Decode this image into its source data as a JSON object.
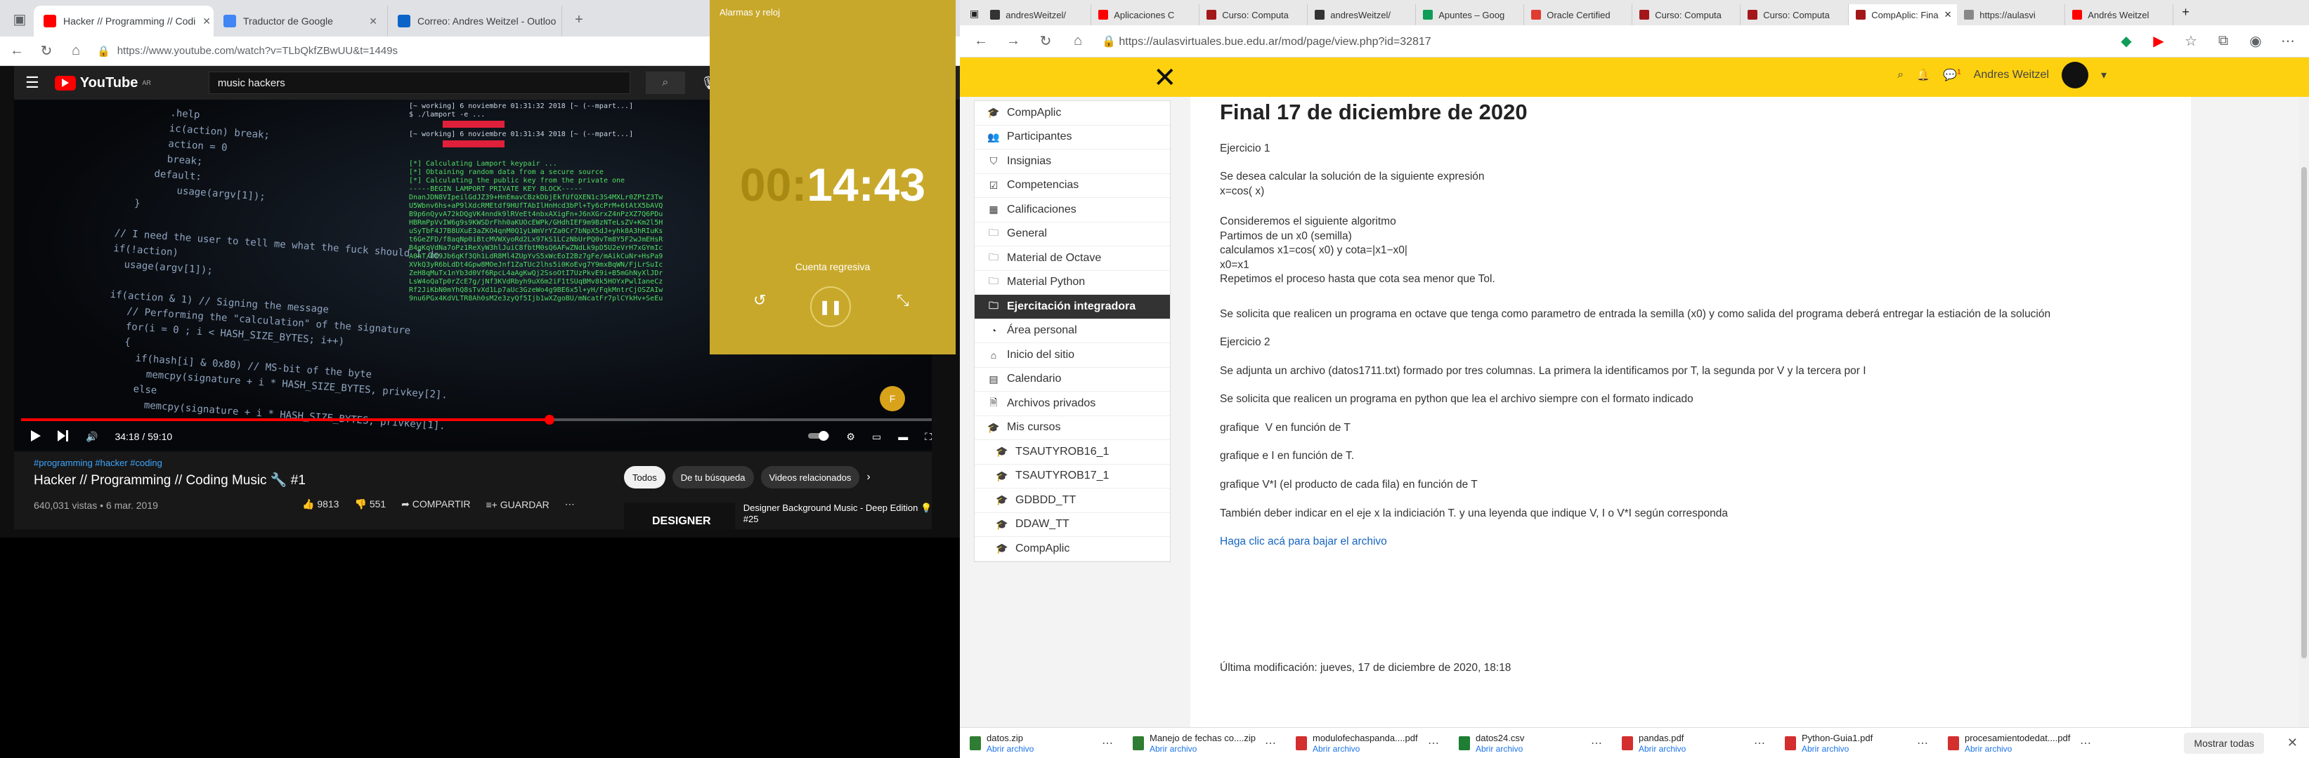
{
  "left_browser": {
    "tabs": [
      {
        "label": "Hacker // Programming // Codi",
        "color": "#ff0000"
      },
      {
        "label": "Traductor de Google",
        "color": "#4285f4"
      },
      {
        "label": "Correo: Andres Weitzel - Outloo",
        "color": "#0a64c8"
      }
    ],
    "url": "https://www.youtube.com/watch?v=TLbQkfZBwUU&t=1449s"
  },
  "youtube": {
    "logo": "YouTube",
    "country": "AR",
    "search": "music hackers",
    "code_lines": "        .help\n        ic(action) break;\n        action = 0\n        break;\n      default:\n          usage(argv[1]);\n   }\n\n// I need the user to tell me what the fuck should I do\nif(!action)\n  usage(argv[1]);\n\nif(action & 1) // Signing the message\n   // Performing the \"calculation\" of the signature\n   for(i = 0 ; i < HASH_SIZE_BYTES; i++)\n   {\n     if(hash[i] & 0x80) // MS-bit of the byte\n       memcpy(signature + i * HASH_SIZE_BYTES, privkey[2].\n     else\n       memcpy(signature + i * HASH_SIZE_BYTES, privkey[1].",
    "terminal_lines": "[*] Calculating Lamport keypair ...\n[*] Obtaining random data from a secure source\n[*] Calculating the public key from the private one\n-----BEGIN LAMPORT PRIVATE KEY BLOCK-----\nDnanJDN8VIpeilGdJZ39+HnEmavCBzkDbjEkfUfQXEN1c3S4MXLr0ZPtZ3Tw\nU5Wbnv6hs+aP9lXdcRMEtdf9HUfTAbIlHnHcd3bPl+Ty6cPrM+6tAtX5bAVQ\nB9p6nQyvA72kDQgVK4nndk9lRVeEt4nbxAXigFn+J6nXGrxZ4nPzXZ7Q6PDu\nHBRmPpVvIW6g9s9KWSDrFhh0aKUOcEWPk/GHdhIEF9m9BzNTeLsZV+Km2l5H\nuSyTbF4J7B8UXuE3aZKO4qnM0Q1yLWmVrYZa0Cr7bNpX5dJ+yhk8A3hRIuKs\nt6GeZFD/f8aqNp0iBtcMVWXyoRd2Lx97kS1LCzNbUrPQ0vTm8Y5F2wJmEHsR\nB4gKqVdNa7oPz1ReXyW3hlJuiC8fbtM0sQ6AFwZNdLk9pD5U2eVrH7xGYmIc\nA0nT/Ot9Jb6qKf3Qh1LdR8Ml4ZUpYvS5xWcEoI2Bz7gFe/mAikCuNr+HsPa9\nXVkQ3yR6bLdDt4Gpw8MOeJnf1ZaTUc2lhs5i0KoEvg7Y9mxBqWN/FjLrSuIc\nZeH8qMuTx1nYb3d0Vf6RpcL4aAgKwQj2SsoOtI7UzPkvE9i+B5mGhNyXlJDr\nLsW4oQaTp0rZcE7g/jNf3KVdRbyh9uX6m2iF1tSUqBMv8k5HOYxPwlIaneCz\nRf2JiKbN0mYhQ8sTvXd1Lp7aUc3GzeWo4g9BE6x5l+yH/FqkMntrCjOSZAIw\n9nu6PGx4KdVLTR8Ah0sM2e3zyQf5Ijb1wXZgoBU/mNcatFr7plCYkHv+SeEu",
    "term_header": "[~ working] 6 noviembre 01:31:32 2018 [~ (--mpart...]\n$ ./lamport -e ...",
    "term_header2": "[~ working] 6 noviembre 01:31:34 2018 [~ (--mpart...]",
    "time": "34:18 / 59:10",
    "progress": 0.58,
    "tags": "#programming #hacker #coding",
    "title": "Hacker // Programming // Coding Music 🔧 #1",
    "meta": "640,031 vistas • 6 mar. 2019",
    "likes": "9813",
    "dislikes": "551",
    "share": "COMPARTIR",
    "save": "GUARDAR",
    "chips": [
      "Todos",
      "De tu búsqueda",
      "Videos relacionados"
    ],
    "rec_thumb": "DESIGNER",
    "rec_title": "Designer Background Music - Deep Edition 💡 #25",
    "corner_icon": "F"
  },
  "clock": {
    "title": "Alarmas y reloj",
    "dim": "00:",
    "time": "14:43",
    "label": "Cuenta regresiva"
  },
  "right_browser": {
    "tabs": [
      {
        "label": "andresWeitzel/",
        "color": "#333333"
      },
      {
        "label": "Aplicaciones C",
        "color": "#ff0000"
      },
      {
        "label": "Curso: Computa",
        "color": "#a3171b"
      },
      {
        "label": "andresWeitzel/",
        "color": "#333333"
      },
      {
        "label": "Apuntes – Goog",
        "color": "#0f9d58"
      },
      {
        "label": "Oracle Certified",
        "color": "#e03c31"
      },
      {
        "label": "Curso: Computa",
        "color": "#a3171b"
      },
      {
        "label": "Curso: Computa",
        "color": "#a3171b"
      },
      {
        "label": "CompAplic: Fina",
        "color": "#a3171b"
      },
      {
        "label": "https://aulasvi",
        "color": "#888888"
      },
      {
        "label": "Andrés Weitzel",
        "color": "#ff0000"
      }
    ],
    "url": "https://aulasvirtuales.bue.edu.ar/mod/page/view.php?id=32817",
    "user": "Andres Weitzel",
    "msg_badge": "1"
  },
  "nav": [
    {
      "label": "CompAplic",
      "icon": "graduation-cap",
      "sub": false
    },
    {
      "label": "Participantes",
      "icon": "users",
      "sub": false
    },
    {
      "label": "Insignias",
      "icon": "shield",
      "sub": false
    },
    {
      "label": "Competencias",
      "icon": "check-square",
      "sub": false
    },
    {
      "label": "Calificaciones",
      "icon": "table",
      "sub": false
    },
    {
      "label": "General",
      "icon": "folder",
      "sub": false
    },
    {
      "label": "Material de Octave",
      "icon": "folder",
      "sub": false
    },
    {
      "label": "Material Python",
      "icon": "folder",
      "sub": false
    },
    {
      "label": "Ejercitación integradora",
      "icon": "folder",
      "sub": false,
      "active": true
    },
    {
      "label": "Área personal",
      "icon": "tachometer",
      "sub": false
    },
    {
      "label": "Inicio del sitio",
      "icon": "home",
      "sub": false
    },
    {
      "label": "Calendario",
      "icon": "calendar",
      "sub": false
    },
    {
      "label": "Archivos privados",
      "icon": "file",
      "sub": false
    },
    {
      "label": "Mis cursos",
      "icon": "graduation-cap",
      "sub": false
    },
    {
      "label": "TSAUTYROB16_1",
      "icon": "graduation-cap",
      "sub": true
    },
    {
      "label": "TSAUTYROB17_1",
      "icon": "graduation-cap",
      "sub": true
    },
    {
      "label": "GDBDD_TT",
      "icon": "graduation-cap",
      "sub": true
    },
    {
      "label": "DDAW_TT",
      "icon": "graduation-cap",
      "sub": true
    },
    {
      "label": "CompAplic",
      "icon": "graduation-cap",
      "sub": true
    }
  ],
  "page": {
    "title": "Final 17 de diciembre de 2020",
    "p1": "Ejercicio 1",
    "p2": "Se desea calcular la solución de la siguiente expresión\nx=cos( x)",
    "p3": "Consideremos el siguiente algoritmo\nPartimos de un x0 (semilla)\ncalculamos x1=cos( x0) y cota=|x1−x0|\nx0=x1\nRepetimos el proceso hasta que cota sea menor que Tol.",
    "p4": "Se solicita que realicen un programa en octave que tenga como parametro de entrada la semilla (x0) y como salida del programa deberá entregar la estiación de la solución",
    "p5": "Ejercicio 2",
    "p6": "Se adjunta un archivo (datos1711.txt) formado por tres columnas. La primera la identificamos por T, la segunda por V y la tercera por I",
    "p7": "Se solicita que realicen un programa en python que lea el archivo siempre con el formato indicado",
    "p8": "grafique  V en función de T",
    "p9": "grafique e I en función de T.",
    "p10": "grafique V*I (el producto de cada fila) en función de T",
    "p11": "También deber indicar en el eje x la indiciación T. y una leyenda que indique V, I o V*I según corresponda",
    "link": "Haga clic acá para bajar el archivo",
    "modified": "Última modificación: jueves, 17 de diciembre de 2020, 18:18"
  },
  "downloads": [
    {
      "name": "datos.zip",
      "color": "#2e7d32"
    },
    {
      "name": "Manejo de fechas co....zip",
      "color": "#2e7d32"
    },
    {
      "name": "modulofechaspanda....pdf",
      "color": "#d32f2f"
    },
    {
      "name": "datos24.csv",
      "color": "#1e7e34"
    },
    {
      "name": "pandas.pdf",
      "color": "#d32f2f"
    },
    {
      "name": "Python-Guia1.pdf",
      "color": "#d32f2f"
    },
    {
      "name": "procesamientodedat....pdf",
      "color": "#d32f2f"
    }
  ],
  "download_action": "Abrir archivo",
  "show_all": "Mostrar todas"
}
